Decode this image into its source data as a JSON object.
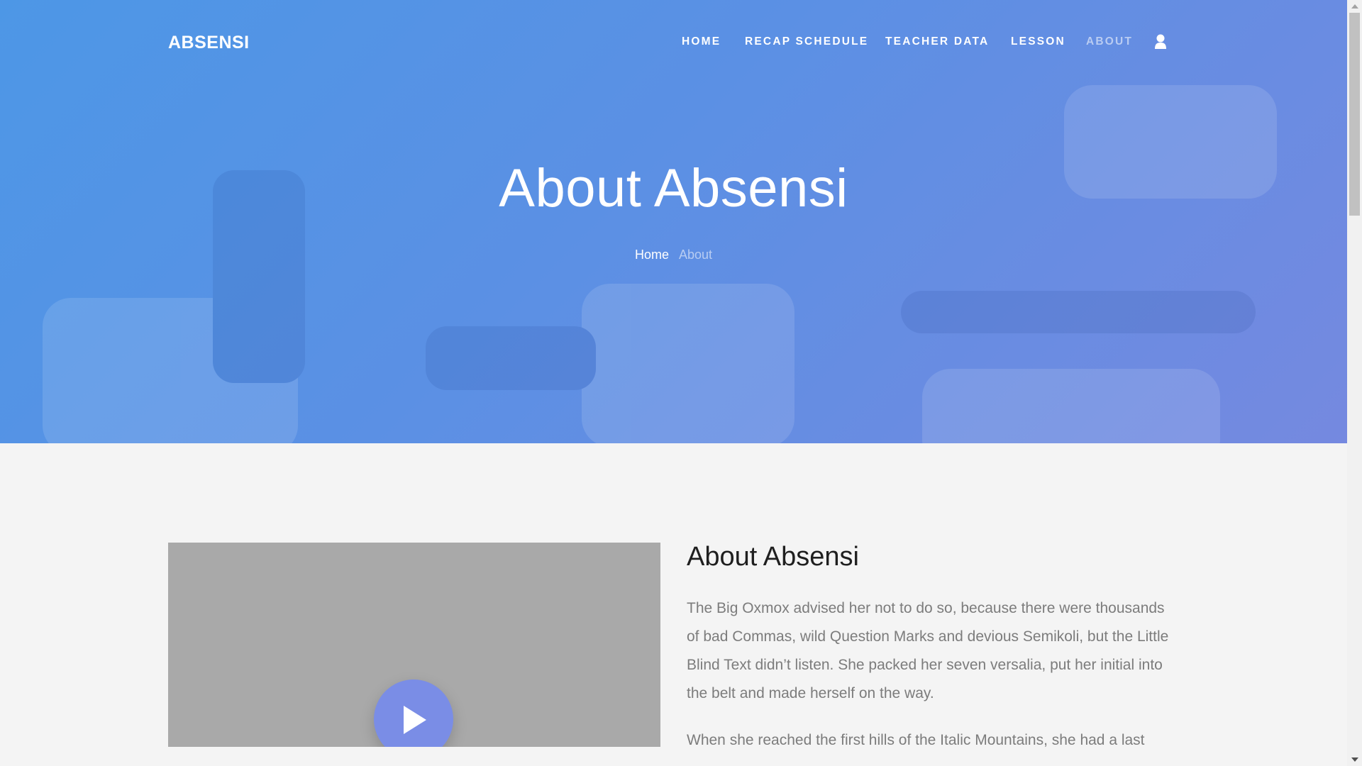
{
  "brand": "ABSENSI",
  "nav": {
    "items": [
      {
        "label": "HOME"
      },
      {
        "label": "RECAP SCHEDULE"
      },
      {
        "label": "TEACHER DATA"
      },
      {
        "label": "LESSON"
      },
      {
        "label": "ABOUT"
      }
    ],
    "user_icon": "user-icon"
  },
  "hero": {
    "title": "About Absensi",
    "breadcrumb": {
      "home": "Home",
      "current": "About"
    }
  },
  "about": {
    "heading": "About Absensi",
    "paragraphs": [
      "The Big Oxmox advised her not to do so, because there were thousands of bad Commas, wild Question Marks and devious Semikoli, but the Little Blind Text didn’t listen. She packed her seven versalia, put her initial into the belt and made herself on the way.",
      "When she reached the first hills of the Italic Mountains, she had a last"
    ]
  },
  "video": {
    "play_icon": "play-icon"
  },
  "colors": {
    "hero_start": "#4d97e6",
    "hero_end": "#7589e0",
    "play_button": "#7a8de6",
    "video_placeholder": "#a9a9a9"
  }
}
